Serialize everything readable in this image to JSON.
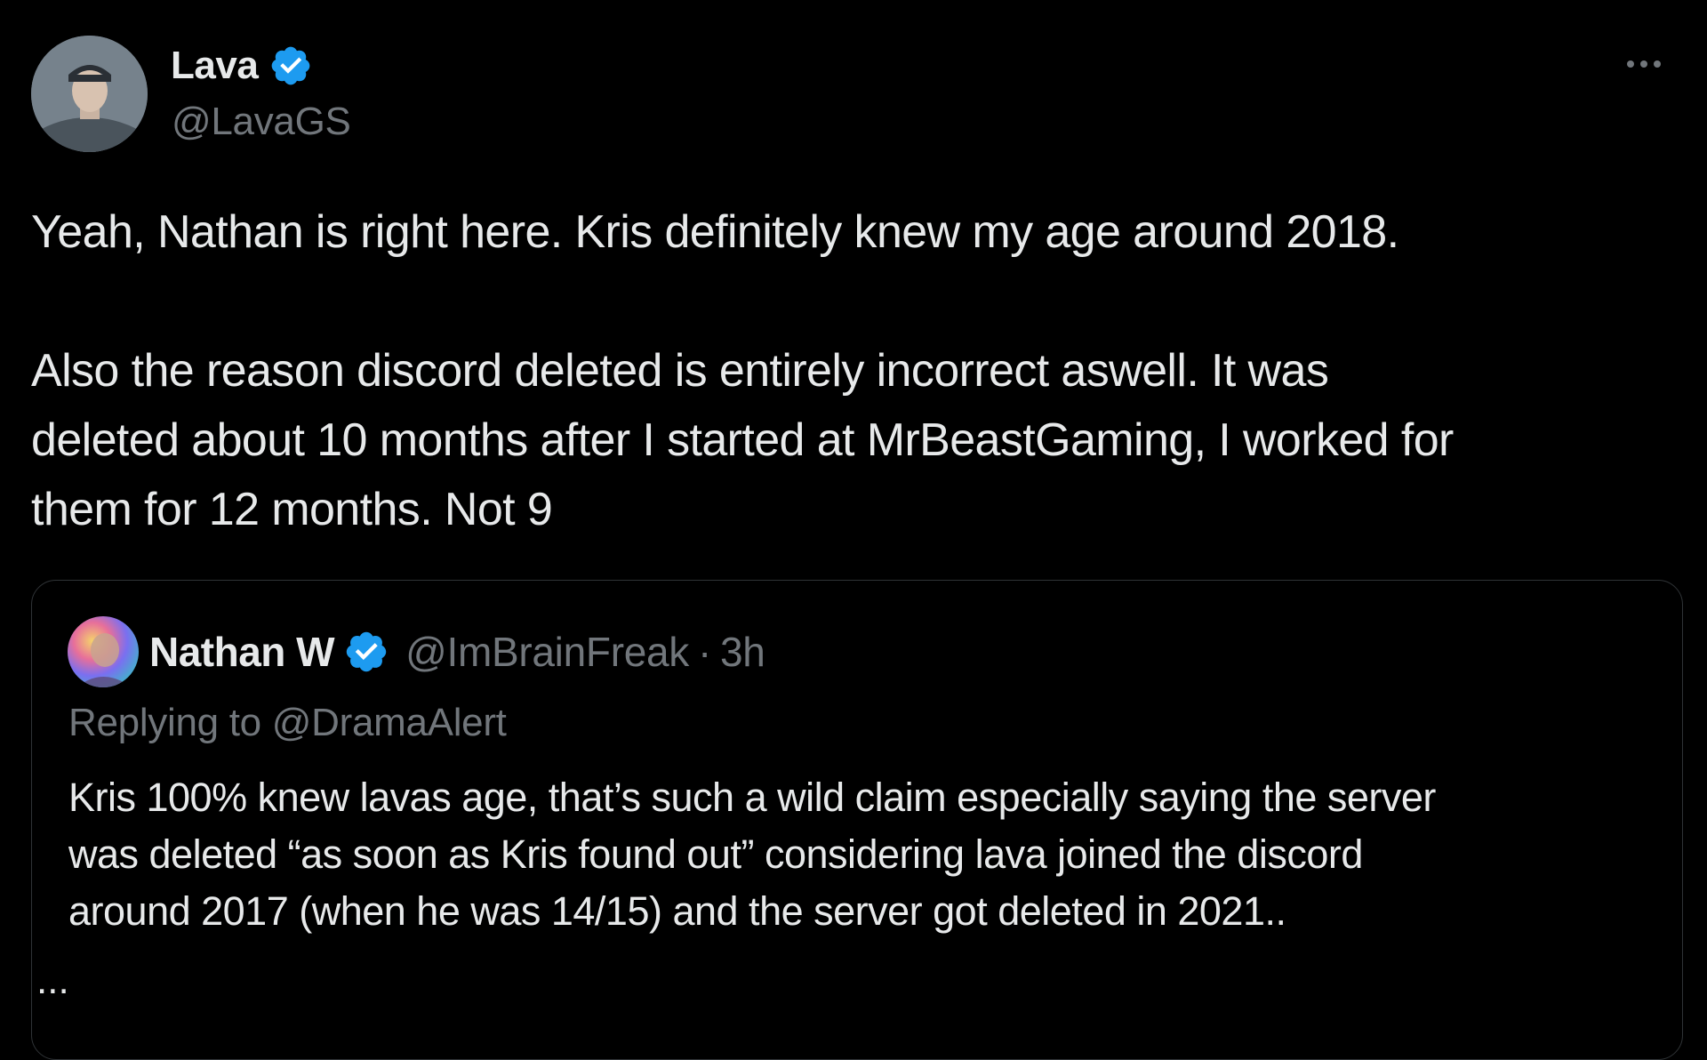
{
  "tweet": {
    "author": {
      "name": "Lava",
      "handle": "@LavaGS",
      "verified": true
    },
    "text_lines": [
      "Yeah, Nathan is right here. Kris definitely knew my age around 2018.",
      "",
      "Also the reason discord deleted is entirely incorrect aswell. It was",
      "deleted about 10 months after I started at MrBeastGaming, I worked for",
      "them for 12 months. Not 9"
    ],
    "more_icon": "more-horizontal-icon"
  },
  "quote": {
    "author": {
      "name": "Nathan W",
      "handle": "@ImBrainFreak",
      "verified": true
    },
    "separator": "·",
    "time": "3h",
    "replying_to": "Replying to @DramaAlert",
    "text_lines": [
      "Kris 100% knew lavas age, that’s such a wild claim especially saying the server",
      "was deleted “as soon as Kris found out” considering lava joined the discord",
      "around 2017 (when he was 14/15) and the server got deleted in 2021.."
    ],
    "truncation": "..."
  },
  "colors": {
    "background": "#000000",
    "primary_text": "#e7e9ea",
    "secondary_text": "#71767b",
    "verified_blue": "#1d9bf0",
    "border": "#2f3336"
  }
}
